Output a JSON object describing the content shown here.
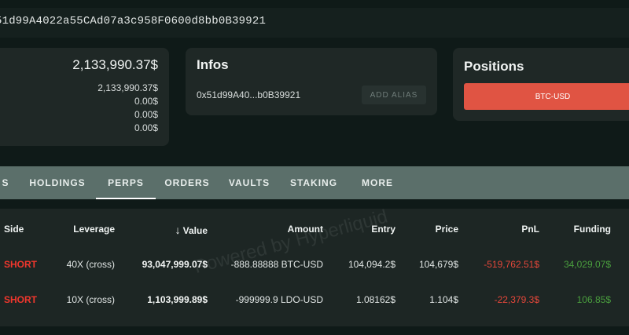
{
  "address": "51d99A4022a55CAd07a3c958F0600d8bb0B39921",
  "balance": {
    "total": "2,133,990.37$",
    "rows": [
      "2,133,990.37$",
      "0.00$",
      "0.00$",
      "0.00$"
    ]
  },
  "infos": {
    "title": "Infos",
    "address_short": "0x51d99A40...b0B39921",
    "add_alias_label": "ADD ALIAS"
  },
  "positions": {
    "title": "Positions",
    "button_label": "BTC-USD",
    "button_color": "#e05443"
  },
  "tabs": [
    "S",
    "HOLDINGS",
    "PERPS",
    "ORDERS",
    "VAULTS",
    "STAKING",
    "MORE"
  ],
  "active_tab": "PERPS",
  "table": {
    "headers": {
      "side": "Side",
      "leverage": "Leverage",
      "value": "Value",
      "value_icon": "arrow-down-icon",
      "amount": "Amount",
      "entry": "Entry",
      "price": "Price",
      "pnl": "PnL",
      "funding": "Funding"
    },
    "rows": [
      {
        "side": "SHORT",
        "leverage": "40X (cross)",
        "value": "93,047,999.07$",
        "amount": "-888.88888 BTC-USD",
        "entry": "104,094.2$",
        "price": "104,679$",
        "pnl": "-519,762.51$",
        "funding": "34,029.07$"
      },
      {
        "side": "SHORT",
        "leverage": "10X (cross)",
        "value": "1,103,999.89$",
        "amount": "-999999.9 LDO-USD",
        "entry": "1.08162$",
        "price": "1.104$",
        "pnl": "-22,379.3$",
        "funding": "106.85$"
      }
    ]
  },
  "watermark": "Powered by Hyperliquid",
  "colors": {
    "short": "#f0372d",
    "negative": "#e5473a",
    "positive": "#4a9e3e",
    "tabs_bg": "#5b6f6a"
  }
}
